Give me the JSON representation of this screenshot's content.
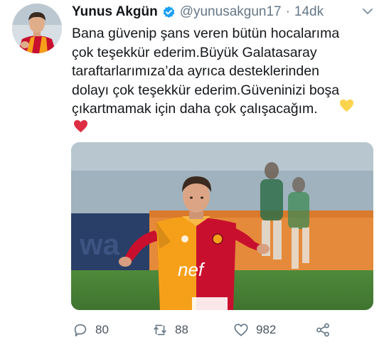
{
  "author": {
    "display_name": "Yunus Akgün",
    "handle": "@yunusakgun17",
    "separator": "·",
    "time_ago": "14dk",
    "verified": true
  },
  "tweet": {
    "text": "Bana güvenip şans veren bütün hocalarıma\nçok teşekkür ederim.Büyük Galatasaray\ntaraftarlarımıza’da ayrıca desteklerinden\ndolayı çok teşekkür ederim.Güveninizi boşa\nçıkartmamak için daha çok çalışacağım.",
    "emojis": [
      "yellow-heart-emoji",
      "red-heart-emoji"
    ]
  },
  "media": {
    "description_icon": "football-player-photo",
    "jersey_text": "nef"
  },
  "actions": {
    "replies": "80",
    "retweets": "88",
    "likes": "982"
  },
  "colors": {
    "text": "#14171a",
    "secondary": "#657786",
    "verified": "#1da1f2",
    "yellow_heart": "#fcd34d",
    "red_heart": "#dd2e44",
    "galatasaray_red": "#c8102e",
    "galatasaray_orange": "#f6a01a"
  }
}
